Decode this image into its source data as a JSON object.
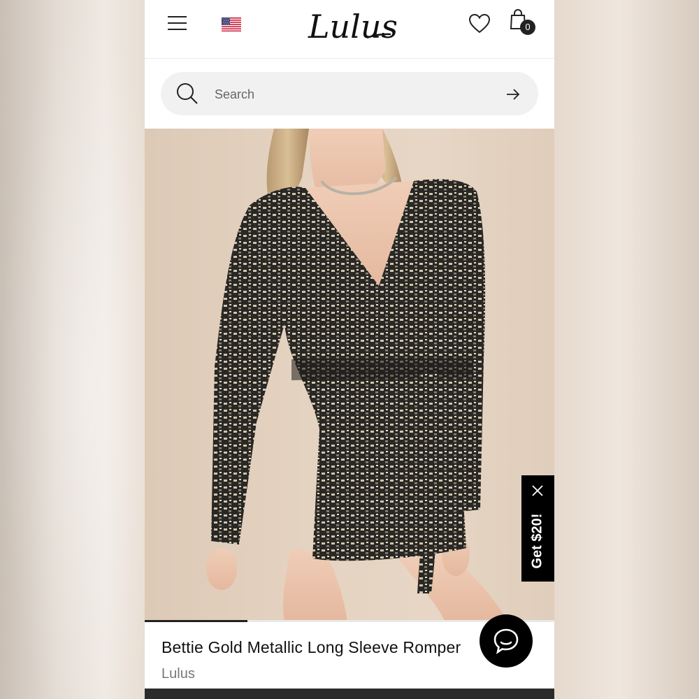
{
  "header": {
    "menu_icon": "hamburger-menu-icon",
    "flag_icon": "us-flag-icon",
    "logo_text": "Lulus",
    "wishlist_icon": "heart-icon",
    "bag_icon": "shopping-bag-icon",
    "bag_count": "0"
  },
  "search": {
    "placeholder": "Search",
    "icon": "search-icon",
    "submit_icon": "arrow-right-icon"
  },
  "gallery": {
    "image_description_icon": "product-photo",
    "progress": 0.25
  },
  "promo": {
    "label": "Get $20!",
    "close_icon": "close-icon"
  },
  "product": {
    "title": "Bettie Gold Metallic Long Sleeve Romper",
    "brand": "Lulus"
  },
  "chat": {
    "icon": "chat-bubble-icon"
  },
  "colors": {
    "accent": "#000000",
    "search_bg": "#f1f1f1",
    "brand_text": "#777777"
  }
}
